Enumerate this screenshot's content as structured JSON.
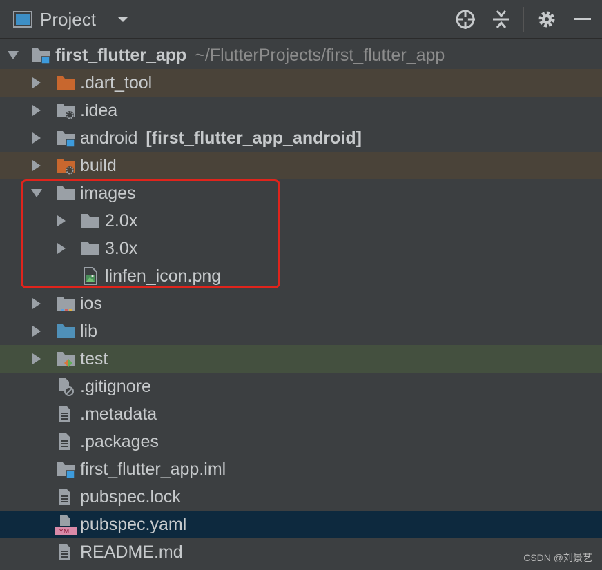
{
  "toolbar": {
    "title": "Project",
    "icons": [
      "project-window-icon",
      "chevron-down-icon",
      "locate-target-icon",
      "collapse-all-icon",
      "gear-icon",
      "minimize-icon"
    ]
  },
  "tree": {
    "root": {
      "name": "first_flutter_app",
      "path": "~/FlutterProjects/first_flutter_app"
    },
    "items": [
      {
        "name": ".dart_tool"
      },
      {
        "name": ".idea"
      },
      {
        "name": "android",
        "module": "[first_flutter_app_android]"
      },
      {
        "name": "build"
      },
      {
        "name": "images"
      },
      {
        "name": "2.0x"
      },
      {
        "name": "3.0x"
      },
      {
        "name": "linfen_icon.png"
      },
      {
        "name": "ios"
      },
      {
        "name": "lib"
      },
      {
        "name": "test"
      },
      {
        "name": ".gitignore"
      },
      {
        "name": ".metadata"
      },
      {
        "name": ".packages"
      },
      {
        "name": "first_flutter_app.iml"
      },
      {
        "name": "pubspec.lock"
      },
      {
        "name": "pubspec.yaml"
      },
      {
        "name": "README.md"
      }
    ]
  },
  "colors": {
    "background": "#3c3f41",
    "excluded_row": "#4a4339",
    "test_row": "#44503f",
    "selected_row": "#0d293e",
    "highlight_border": "#e0241c",
    "folder_gray": "#9aa0a6",
    "folder_orange": "#c8672e",
    "folder_blue": "#4f90b8",
    "module_badge": "#3d9bdc"
  },
  "yml_badge": "YML",
  "watermark": "CSDN @刘景艺"
}
